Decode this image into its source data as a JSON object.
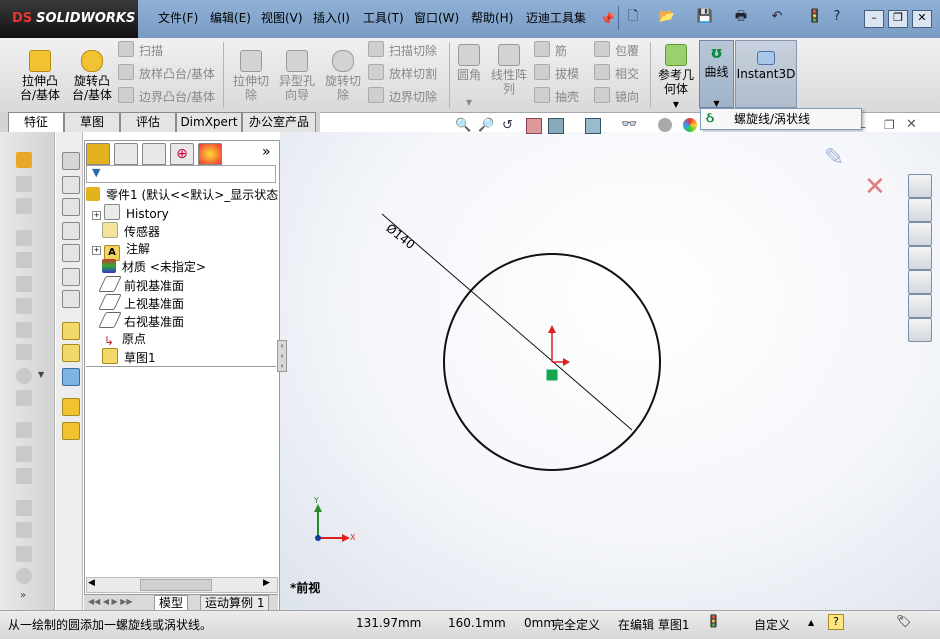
{
  "app": {
    "logo_mark": "DS",
    "logo_text": "SOLIDWORKS"
  },
  "menu": [
    "文件(F)",
    "编辑(E)",
    "视图(V)",
    "插入(I)",
    "工具(T)",
    "窗口(W)",
    "帮助(H)",
    "迈迪工具集"
  ],
  "ribbon": {
    "extrude_boss": [
      "拉伸凸",
      "台/基体"
    ],
    "revolve_boss": [
      "旋转凸",
      "台/基体"
    ],
    "sweep": "扫描",
    "loft_boss": "放样凸台/基体",
    "boundary_boss": "边界凸台/基体",
    "extrude_cut": [
      "拉伸切",
      "除"
    ],
    "hole_wizard": [
      "异型孔",
      "向导"
    ],
    "revolve_cut": [
      "旋转切",
      "除"
    ],
    "sweep_cut": "扫描切除",
    "loft_cut": "放样切割",
    "boundary_cut": "边界切除",
    "fillet": "圆角",
    "linear_pattern": [
      "线性阵",
      "列"
    ],
    "rib": "筋",
    "draft": "拔模",
    "shell": "抽壳",
    "wrap": "包覆",
    "intersect": "相交",
    "mirror": "镜向",
    "reference_geometry": [
      "参考几",
      "何体"
    ],
    "curves": "曲线",
    "instant3d": "Instant3D"
  },
  "dropdown": {
    "helix_spiral": "螺旋线/涡状线"
  },
  "cm_tabs": [
    "特征",
    "草图",
    "评估",
    "DimXpert",
    "办公室产品"
  ],
  "tree": {
    "root": "零件1  (默认<<默认>_显示状态",
    "items": [
      "History",
      "传感器",
      "注解",
      "材质 <未指定>",
      "前视基准面",
      "上视基准面",
      "右视基准面",
      "原点",
      "草图1"
    ]
  },
  "graphics": {
    "dimension": "Ø140",
    "view_label": "*前视",
    "axis_x": "X",
    "axis_y": "Y"
  },
  "bottom_tabs": [
    "模型",
    "运动算例 1"
  ],
  "status": {
    "message": "从一绘制的圆添加一螺旋线或涡状线。",
    "x": "131.97mm",
    "y": "160.1mm",
    "z": "0mm",
    "definition": "完全定义",
    "editing": "在编辑 草图1",
    "units": "自定义"
  },
  "colors": {
    "accent": "#3f6fb0",
    "sketch_green": "#19a34a",
    "axis_red": "#e02020",
    "tree_icon_yellow": "#e3b21f"
  }
}
